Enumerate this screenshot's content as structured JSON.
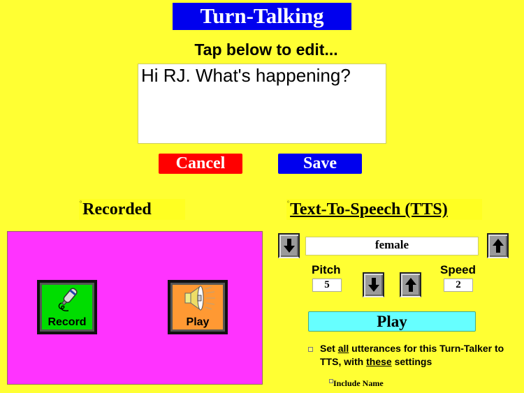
{
  "header": {
    "title": "Turn-Talking",
    "instruction": "Tap  below to edit..."
  },
  "editor": {
    "text": "Hi RJ.  What's happening?"
  },
  "actions": {
    "cancel_label": "Cancel",
    "save_label": "Save"
  },
  "recorded": {
    "marker": "◦",
    "heading": "Recorded",
    "record_label": "Record",
    "play_label": "Play",
    "record_icon": "microphone-icon",
    "play_icon": "speaker-icon"
  },
  "tts": {
    "marker": "◦",
    "heading": "Text-To-Speech (TTS)",
    "voice": "female",
    "pitch_label": "Pitch",
    "pitch_value": "5",
    "speed_label": "Speed",
    "speed_value": "2",
    "play_label": "Play",
    "set_all_pre": "Set ",
    "set_all_em1": "all",
    "set_all_mid": " utterances for this Turn-Talker to TTS, with ",
    "set_all_em2": "these",
    "set_all_post": " settings",
    "include_name_label": "Include Name"
  },
  "colors": {
    "background": "#ffff33",
    "title_bg": "#0000ee",
    "cancel_bg": "#ff0000",
    "save_bg": "#0000ee",
    "panel_bg": "#ff33ff",
    "record_bg": "#00dd00",
    "play_bg": "#ff9933",
    "tts_play_bg": "#66ffff"
  }
}
